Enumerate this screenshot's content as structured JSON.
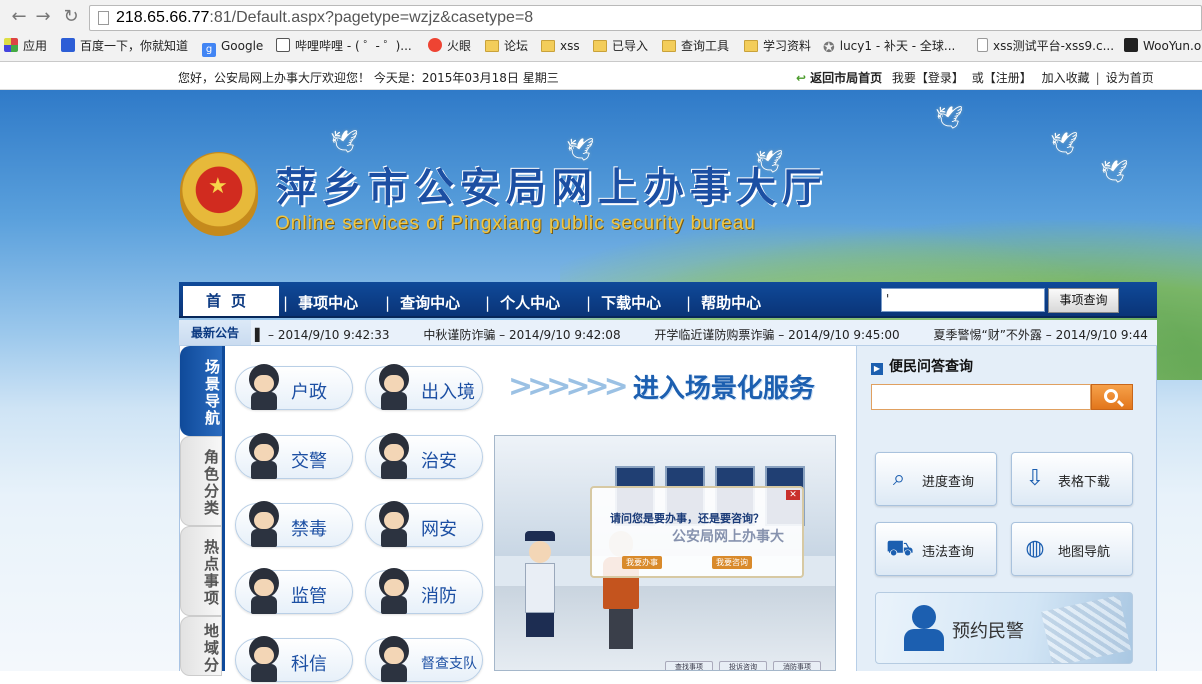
{
  "browser": {
    "back_icon": "back-arrow-icon",
    "forward_icon": "forward-arrow-icon",
    "reload_icon": "reload-icon",
    "url_host": "218.65.66.77",
    "url_rest": ":81/Default.aspx?pagetype=wzjz&casetype=8",
    "bookmarks": [
      {
        "label": "应用",
        "icon": "apps-icon"
      },
      {
        "label": "百度一下，你就知道",
        "icon": "baidu-icon"
      },
      {
        "label": "Google",
        "icon": "google-icon"
      },
      {
        "label": "哔哩哔哩 - ( ゜- ゜)...",
        "icon": "bilibili-icon"
      },
      {
        "label": "火眼",
        "icon": "fire-eye-icon"
      },
      {
        "label": "论坛",
        "icon": "folder-icon"
      },
      {
        "label": "xss",
        "icon": "folder-icon"
      },
      {
        "label": "已导入",
        "icon": "folder-icon"
      },
      {
        "label": "查询工具",
        "icon": "folder-icon"
      },
      {
        "label": "学习资料",
        "icon": "folder-icon"
      },
      {
        "label": "lucy1 - 补天 - 全球...",
        "icon": "star-icon"
      },
      {
        "label": "xss测试平台-xss9.c...",
        "icon": "page-icon"
      },
      {
        "label": "WooYun.o",
        "icon": "wooyun-icon"
      }
    ]
  },
  "topbar": {
    "greeting": "您好，公安局网上办事大厅欢迎您！  今天是：2015年03月18日  星期三",
    "return_home": "返回市局首页",
    "want": "我要",
    "login": "【登录】",
    "or": "或",
    "register": "【注册】",
    "favorite": "加入收藏",
    "set_home": "设为首页"
  },
  "banner": {
    "title": "萍乡市公安局网上办事大厅",
    "subtitle": "Online services of Pingxiang public security bureau"
  },
  "nav": {
    "home": "首页",
    "items": [
      "事项中心",
      "查询中心",
      "个人中心",
      "下载中心",
      "帮助中心"
    ],
    "search_value": "'",
    "search_button": "事项查询"
  },
  "notice": {
    "label": "最新公告",
    "items": [
      {
        "title": "",
        "time": "2014/9/10 9:42:33"
      },
      {
        "title": "中秋谨防诈骗",
        "time": "2014/9/10 9:42:08"
      },
      {
        "title": "开学临近谨防购票诈骗",
        "time": "2014/9/10 9:45:00"
      },
      {
        "title": "夏季警惕“财”不外露",
        "time": "2014/9/10 9:44"
      }
    ]
  },
  "side_tabs": [
    {
      "label": "场景导航",
      "active": true
    },
    {
      "label": "角色分类",
      "active": false
    },
    {
      "label": "热点事项",
      "active": false
    },
    {
      "label": "地域分",
      "active": false
    }
  ],
  "services": [
    {
      "label": "户政"
    },
    {
      "label": "出入境"
    },
    {
      "label": "交警"
    },
    {
      "label": "治安"
    },
    {
      "label": "禁毒"
    },
    {
      "label": "网安"
    },
    {
      "label": "监管"
    },
    {
      "label": "消防"
    },
    {
      "label": "科信"
    },
    {
      "label": "督查支队"
    }
  ],
  "scene": {
    "heading": "进入场景化服务",
    "question": "请问您是要办事，还是要咨询？",
    "overlay_text": "公安局网上办事大",
    "option_handle": "我要办事",
    "option_consult": "我要咨询",
    "bottom_buttons": [
      "查找事项",
      "投诉咨询",
      "消防事项"
    ]
  },
  "faq": {
    "title": "便民问答查询",
    "placeholder": "",
    "buttons": [
      {
        "label": "进度查询",
        "icon": "magnifier-icon"
      },
      {
        "label": "表格下载",
        "icon": "download-arrow-icon"
      },
      {
        "label": "违法查询",
        "icon": "truck-icon"
      },
      {
        "label": "地图导航",
        "icon": "globe-icon"
      }
    ],
    "appointment": "预约民警"
  },
  "colors": {
    "nav_blue": "#0f4a9a",
    "title_blue": "#1c4fa3",
    "search_orange": "#e2761b"
  }
}
